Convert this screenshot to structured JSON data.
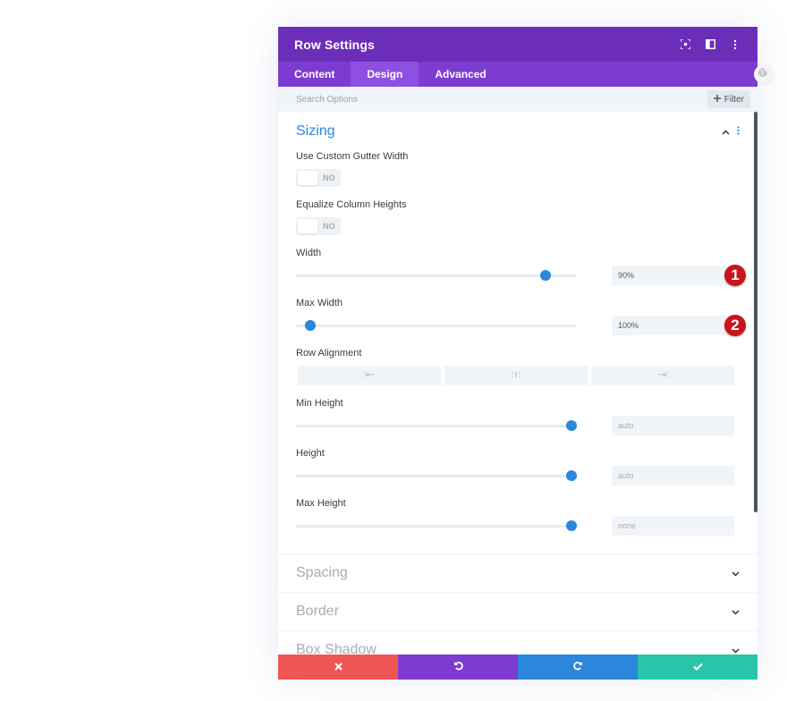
{
  "modal": {
    "title": "Row Settings",
    "header_icons": [
      "fullscreen-icon",
      "split-view-icon",
      "more-vertical-icon"
    ]
  },
  "tabs": [
    {
      "label": "Content",
      "active": false
    },
    {
      "label": "Design",
      "active": true
    },
    {
      "label": "Advanced",
      "active": false
    }
  ],
  "search": {
    "placeholder": "Search Options",
    "filter_label": "Filter",
    "filter_icon": "plus-icon"
  },
  "sections": {
    "sizing": {
      "title": "Sizing",
      "expanded": true,
      "fields": {
        "gutter": {
          "label": "Use Custom Gutter Width",
          "value": "NO"
        },
        "equalize": {
          "label": "Equalize Column Heights",
          "value": "NO"
        },
        "width": {
          "label": "Width",
          "value": "90%",
          "slider_fraction": 0.89,
          "badge": "1"
        },
        "max_width": {
          "label": "Max Width",
          "value": "100%",
          "slider_fraction": 0.05,
          "badge": "2"
        },
        "row_alignment": {
          "label": "Row Alignment",
          "options": [
            "align-left-icon",
            "align-center-icon",
            "align-right-icon"
          ]
        },
        "min_height": {
          "label": "Min Height",
          "value": "auto",
          "slider_fraction": 0.985
        },
        "height": {
          "label": "Height",
          "value": "auto",
          "slider_fraction": 0.985
        },
        "max_height": {
          "label": "Max Height",
          "value": "none",
          "slider_fraction": 0.985
        }
      }
    },
    "collapsed": [
      {
        "title": "Spacing"
      },
      {
        "title": "Border"
      },
      {
        "title": "Box Shadow"
      }
    ]
  },
  "footer": {
    "buttons": [
      {
        "name": "discard",
        "icon": "close-icon",
        "color": "#ef5555"
      },
      {
        "name": "undo",
        "icon": "undo-icon",
        "color": "#7e3bd0"
      },
      {
        "name": "redo",
        "icon": "redo-icon",
        "color": "#2b87da"
      },
      {
        "name": "save",
        "icon": "check-icon",
        "color": "#29c4a9"
      }
    ]
  },
  "colors": {
    "header": "#6c2eb9",
    "tabs": "#7d3bd1",
    "active_tab": "#8f4fe0",
    "accent": "#2b87da",
    "badge": "#c8141a"
  }
}
